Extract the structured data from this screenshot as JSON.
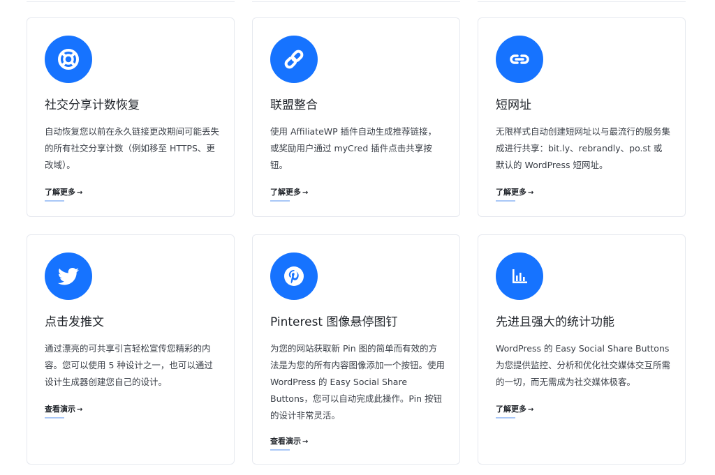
{
  "colors": {
    "accent": "#1673ff",
    "link_underline": "#a9c7f7",
    "card_border": "#e6e9ef"
  },
  "cards": [
    {
      "icon": "lifebuoy-icon",
      "title": "社交分享计数恢复",
      "desc": "自动恢复您以前在永久链接更改期间可能丢失的所有社交分享计数（例如移至 HTTPS、更改域）。",
      "link": "了解更多",
      "arrow": "→"
    },
    {
      "icon": "link-icon",
      "title": "联盟整合",
      "desc": "使用 AffiliateWP 插件自动生成推荐链接，或奖励用户通过 myCred 插件点击共享按钮。",
      "link": "了解更多",
      "arrow": "→"
    },
    {
      "icon": "short-link-icon",
      "title": "短网址",
      "desc": "无限样式自动创建短网址以与最流行的服务集成进行共享：bit.ly、rebrandly、po.st 或默认的 WordPress 短网址。",
      "link": "了解更多",
      "arrow": "→"
    },
    {
      "icon": "twitter-icon",
      "title": "点击发推文",
      "desc": "通过漂亮的可共享引言轻松宣传您精彩的内容。您可以使用 5 种设计之一，也可以通过设计生成器创建您自己的设计。",
      "link": "查看演示",
      "arrow": "→"
    },
    {
      "icon": "pinterest-icon",
      "title": "Pinterest 图像悬停图钉",
      "desc": "为您的网站获取新 Pin 图的简单而有效的方法是为您的所有内容图像添加一个按钮。使用 WordPress 的 Easy Social Share Buttons，您可以自动完成此操作。Pin 按钮的设计非常灵活。",
      "link": "查看演示",
      "arrow": "→"
    },
    {
      "icon": "bar-chart-icon",
      "title": "先进且强大的统计功能",
      "desc": "WordPress 的 Easy Social Share Buttons 为您提供监控、分析和优化社交媒体交互所需的一切，而无需成为社交媒体极客。",
      "link": "了解更多",
      "arrow": "→"
    }
  ]
}
